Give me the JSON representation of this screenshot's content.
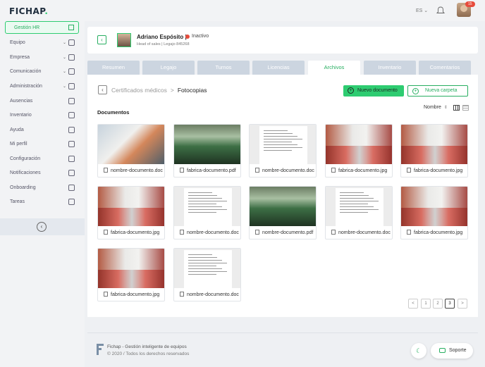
{
  "app": {
    "logo": "FICHAP",
    "language": "ES",
    "notification_count": "15"
  },
  "sidebar": {
    "gestion": "Gestión HR",
    "items": [
      {
        "label": "Equipo",
        "has_chevron": true
      },
      {
        "label": "Empresa",
        "has_chevron": true
      },
      {
        "label": "Comunicación",
        "has_chevron": true
      },
      {
        "label": "Administración",
        "has_chevron": true
      },
      {
        "label": "Ausencias"
      },
      {
        "label": "Inventario"
      },
      {
        "label": "Ayuda"
      },
      {
        "label": "Mi perfil"
      },
      {
        "label": "Configuración"
      },
      {
        "label": "Notificaciones"
      },
      {
        "label": "Onboarding"
      },
      {
        "label": "Tareas"
      }
    ]
  },
  "employee": {
    "name": "Adriano Espósito |",
    "status": "Inactivo",
    "meta": "Head of sales  |  Legajo 845268"
  },
  "tabs": [
    "Resumen",
    "Legajo",
    "Turnos",
    "Licencias",
    "Archivos",
    "Inventario",
    "Comentarios"
  ],
  "active_tab": "Archivos",
  "breadcrumb": {
    "parent": "Certificados médicos",
    "sep": ">",
    "current": "Fotocopias"
  },
  "actions": {
    "new_doc": "Nuevo documento",
    "new_folder": "Nueva carpeta"
  },
  "section_title": "Documentos",
  "sort_label": "Nombre",
  "documents": [
    {
      "name": "nombre-documento.doc",
      "thumb": "robot"
    },
    {
      "name": "fabrica-documento.pdf",
      "thumb": "green"
    },
    {
      "name": "nombre-documento.doc",
      "thumb": "text"
    },
    {
      "name": "fabrica-documento.jpg",
      "thumb": "ind"
    },
    {
      "name": "fabrica-documento.jpg",
      "thumb": "ind"
    },
    {
      "name": "fabrica-documento.jpg",
      "thumb": "ind"
    },
    {
      "name": "nombre-documento.doc",
      "thumb": "text"
    },
    {
      "name": "nombre-documento.pdf",
      "thumb": "green"
    },
    {
      "name": "nombre-documento.doc",
      "thumb": "text"
    },
    {
      "name": "fabrica-documento.jpg",
      "thumb": "ind"
    },
    {
      "name": "fabrica-documento.jpg",
      "thumb": "ind"
    },
    {
      "name": "nombre-documento.doc",
      "thumb": "text"
    }
  ],
  "pagination": {
    "pages": [
      "1",
      "2",
      "3"
    ],
    "current": "3",
    "prev": "<",
    "next": ">"
  },
  "footer": {
    "line1": "Fichap - Gestión inteligente de equipos",
    "line2": "© 2020 / Todos los derechos reservados",
    "support": "Soporte"
  }
}
